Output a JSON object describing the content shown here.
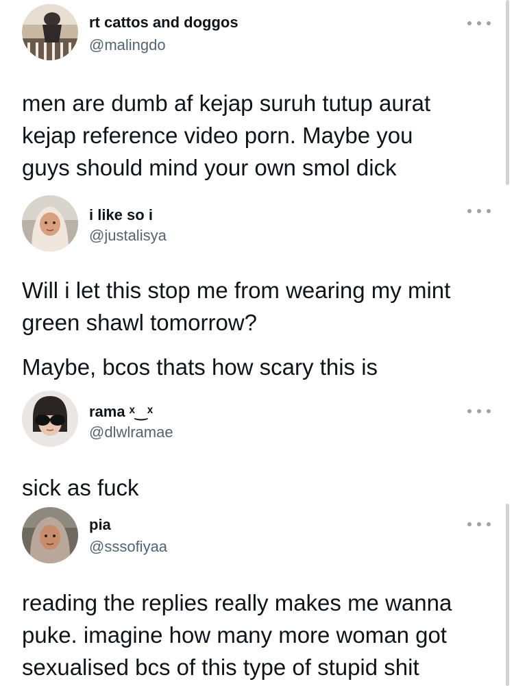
{
  "tweets": [
    {
      "name": "rt cattos and doggos",
      "handle": "@malingdo",
      "lines": [
        "men are dumb af kejap suruh tutup aurat",
        "kejap reference video porn. Maybe you",
        "guys should mind your own smol dick"
      ]
    },
    {
      "name": "i like so i",
      "handle": "@justalisya",
      "lines": [
        "Will i let this stop me from wearing my mint",
        "green shawl tomorrow?",
        "Maybe, bcos thats how scary this is"
      ]
    },
    {
      "name": "rama ˣ‿ˣ",
      "handle": "@dlwlramae",
      "lines": [
        "sick as fuck"
      ]
    },
    {
      "name": "pia",
      "handle": "@sssofiyaa",
      "lines": [
        "reading the replies really makes me wanna",
        "puke. imagine how many more woman got",
        "sexualised bcs of this type of stupid shit"
      ]
    }
  ],
  "icons": {
    "more": "more-horizontal-icon"
  },
  "colors": {
    "text": "#0f1419",
    "handle": "#536471",
    "more_dots": "#9aa4ad"
  }
}
